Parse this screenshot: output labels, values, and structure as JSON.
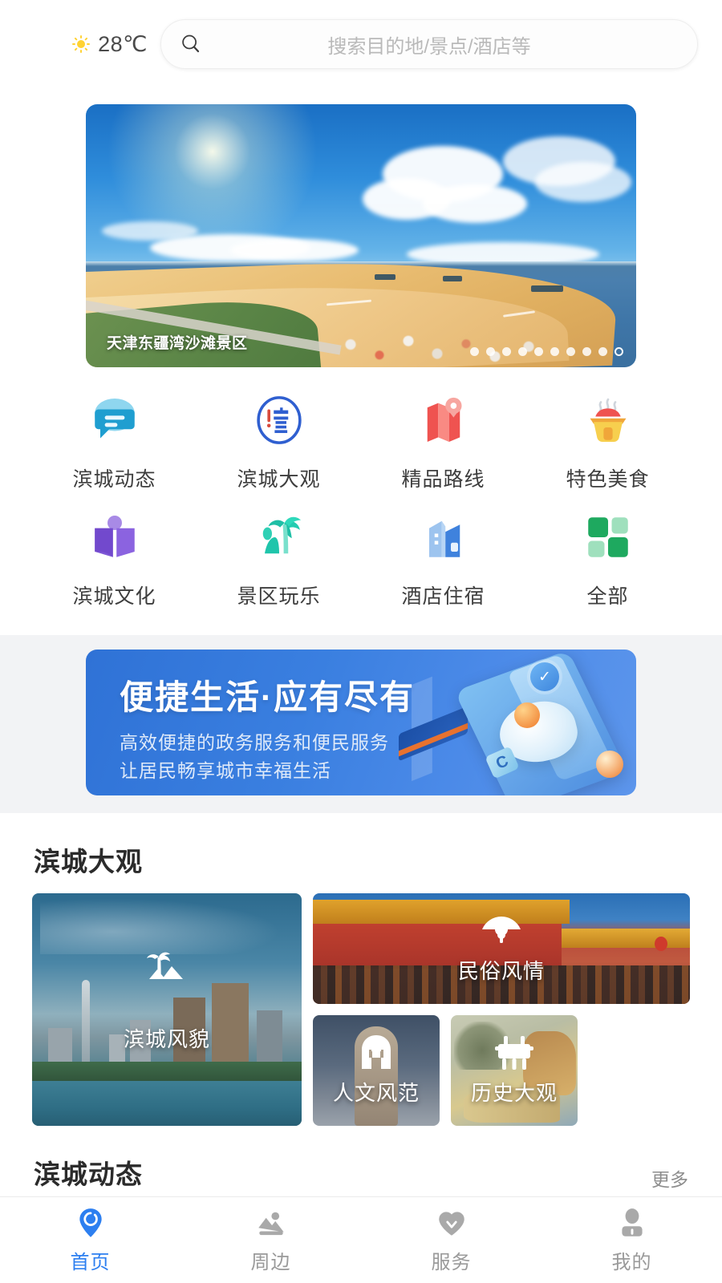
{
  "header": {
    "weather_icon": "sun-icon",
    "temperature": "28℃",
    "search": {
      "icon": "search-icon",
      "value": "",
      "placeholder": "搜索目的地/景点/酒店等"
    }
  },
  "hero": {
    "caption": "天津东疆湾沙滩景区",
    "dots_total": 10,
    "dots_active_index": 9
  },
  "quick_grid": [
    {
      "label": "滨城动态",
      "icon": "chat-bubble-icon",
      "color": "#29a3d9"
    },
    {
      "label": "滨城大观",
      "icon": "bin-circle-logo-icon",
      "color": "#2f5fd0"
    },
    {
      "label": "精品路线",
      "icon": "map-pin-icon",
      "color": "#ef5350"
    },
    {
      "label": "特色美食",
      "icon": "food-bowl-icon",
      "color": "#f5c33b"
    },
    {
      "label": "滨城文化",
      "icon": "open-book-icon",
      "color": "#7e57d6"
    },
    {
      "label": "景区玩乐",
      "icon": "palm-tree-icon",
      "color": "#26c6a8"
    },
    {
      "label": "酒店住宿",
      "icon": "hotel-building-icon",
      "color": "#4a8fe0"
    },
    {
      "label": "全部",
      "icon": "grid-squares-icon",
      "color": "#21a664"
    }
  ],
  "promo": {
    "title": "便捷生活·应有尽有",
    "subtitle_line1": "高效便捷的政务服务和便民服务",
    "subtitle_line2": "让居民畅享城市幸福生活",
    "bg_color": "#3a7fe0"
  },
  "gallery_section": {
    "title": "滨城大观",
    "tiles": [
      {
        "label": "滨城风貌",
        "icon": "palm-mountain-icon"
      },
      {
        "label": "民俗风情",
        "icon": "fan-icon"
      },
      {
        "label": "人文风范",
        "icon": "helmet-icon"
      },
      {
        "label": "历史大观",
        "icon": "ding-vessel-icon"
      }
    ]
  },
  "news_section": {
    "title": "滨城动态",
    "more_label": "更多"
  },
  "tabbar": {
    "active_color": "#2d7ff0",
    "inactive_color": "#9a9a9a",
    "items": [
      {
        "label": "首页",
        "icon": "location-pin-icon",
        "active": true
      },
      {
        "label": "周边",
        "icon": "image-mountain-icon",
        "active": false
      },
      {
        "label": "服务",
        "icon": "heart-icon",
        "active": false
      },
      {
        "label": "我的",
        "icon": "person-icon",
        "active": false
      }
    ]
  }
}
